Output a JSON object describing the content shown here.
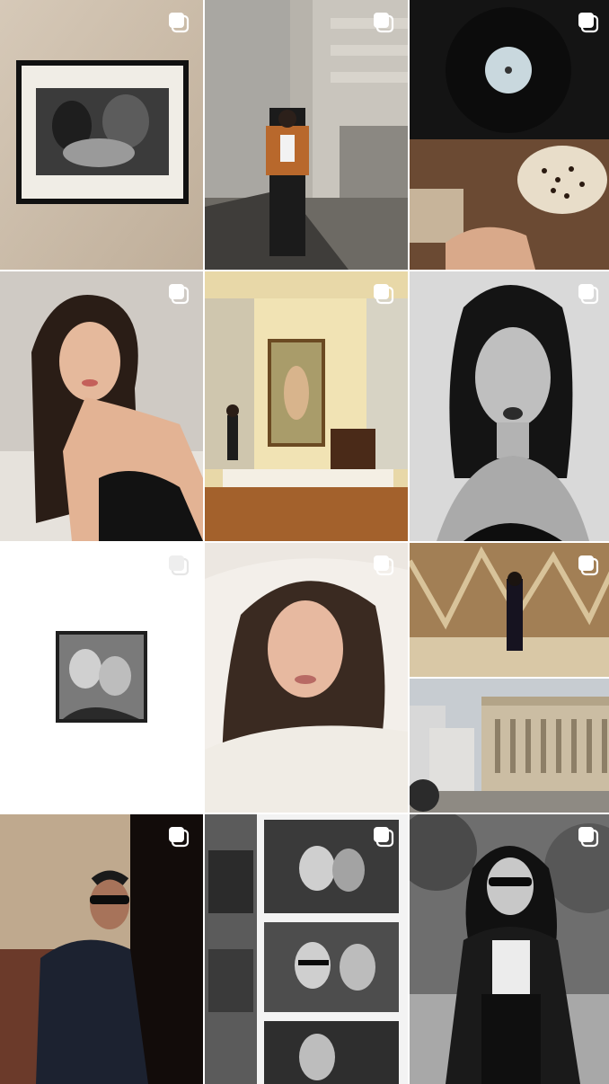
{
  "profile_grid": {
    "posts": [
      {
        "id": "p1",
        "subject": "framed-photo",
        "badge": "carousel-icon"
      },
      {
        "id": "p2",
        "subject": "woman-at-building",
        "badge": "carousel-icon"
      },
      {
        "id": "p3",
        "subject": "record-and-cocktail",
        "badge": "carousel-icon"
      },
      {
        "id": "p4",
        "subject": "portrait-black-dress",
        "badge": "carousel-icon"
      },
      {
        "id": "p5",
        "subject": "museum-painting",
        "badge": "carousel-icon"
      },
      {
        "id": "p6",
        "subject": "bw-portrait",
        "badge": "carousel-icon"
      },
      {
        "id": "p7",
        "subject": "photobooth-print",
        "badge": "carousel-icon"
      },
      {
        "id": "p8",
        "subject": "selfie-white-sweater",
        "badge": "carousel-icon"
      },
      {
        "id": "p9",
        "subject": "gallery-and-city",
        "badge": "carousel-icon"
      },
      {
        "id": "p10",
        "subject": "woman-sunglasses-denim",
        "badge": "carousel-icon"
      },
      {
        "id": "p11",
        "subject": "photobooth-strips",
        "badge": "carousel-icon"
      },
      {
        "id": "p12",
        "subject": "bw-woman-park",
        "badge": "carousel-icon"
      }
    ],
    "colors": {
      "background": "#ffffff",
      "badge": "#ffffff"
    }
  }
}
